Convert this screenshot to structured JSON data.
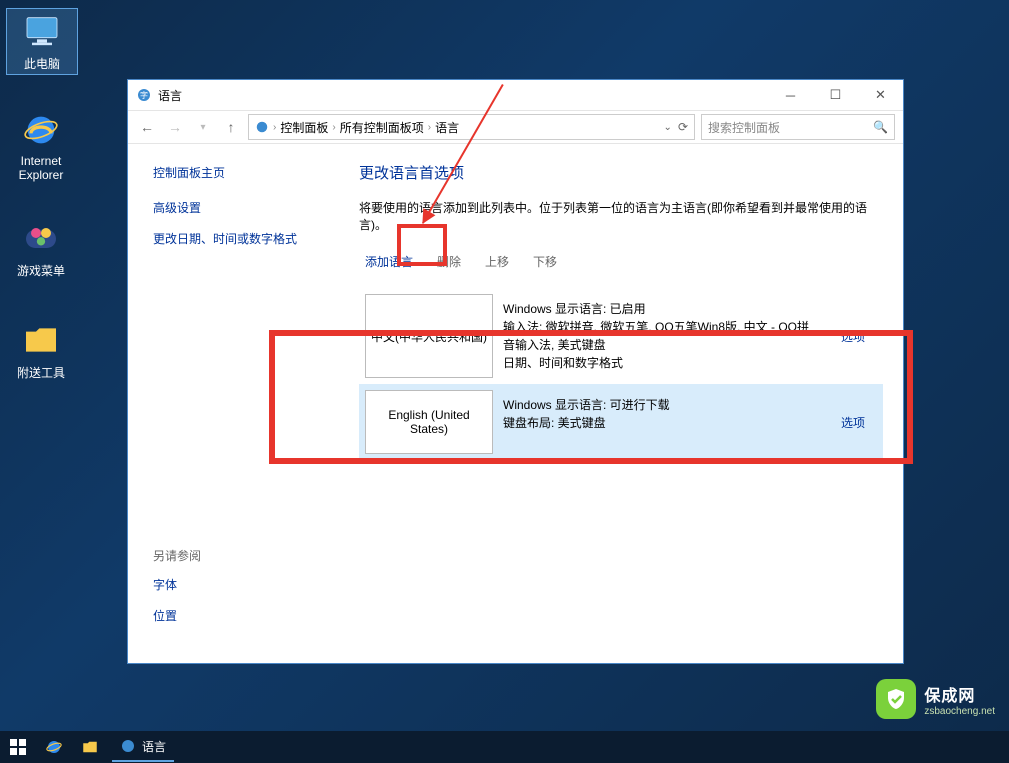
{
  "desktop": {
    "this_pc": "此电脑",
    "ie": "Internet\nExplorer",
    "games": "游戏菜单",
    "tools": "附送工具"
  },
  "window": {
    "title": "语言",
    "breadcrumb": [
      "控制面板",
      "所有控制面板项",
      "语言"
    ],
    "search_placeholder": "搜索控制面板"
  },
  "sidebar": {
    "home": "控制面板主页",
    "advanced": "高级设置",
    "datetime": "更改日期、时间或数字格式",
    "see_also": "另请参阅",
    "font": "字体",
    "location": "位置"
  },
  "main": {
    "heading": "更改语言首选项",
    "description": "将要使用的语言添加到此列表中。位于列表第一位的语言为主语言(即你希望看到并最常使用的语言)。",
    "actions": {
      "add": "添加语言",
      "remove": "删除",
      "up": "上移",
      "down": "下移"
    },
    "languages": [
      {
        "name": "中文(中华人民共和国)",
        "meta": "Windows 显示语言: 已启用\n输入法: 微软拼音, 微软五笔, QQ五笔Win8版, 中文 - QQ拼音输入法, 美式键盘\n日期、时间和数字格式",
        "options": "选项"
      },
      {
        "name": "English (United States)",
        "meta": "Windows 显示语言: 可进行下载\n键盘布局: 美式键盘",
        "options": "选项"
      }
    ]
  },
  "taskbar": {
    "task_label": "语言"
  },
  "watermark": {
    "name": "保成网",
    "url": "zsbaocheng.net"
  }
}
